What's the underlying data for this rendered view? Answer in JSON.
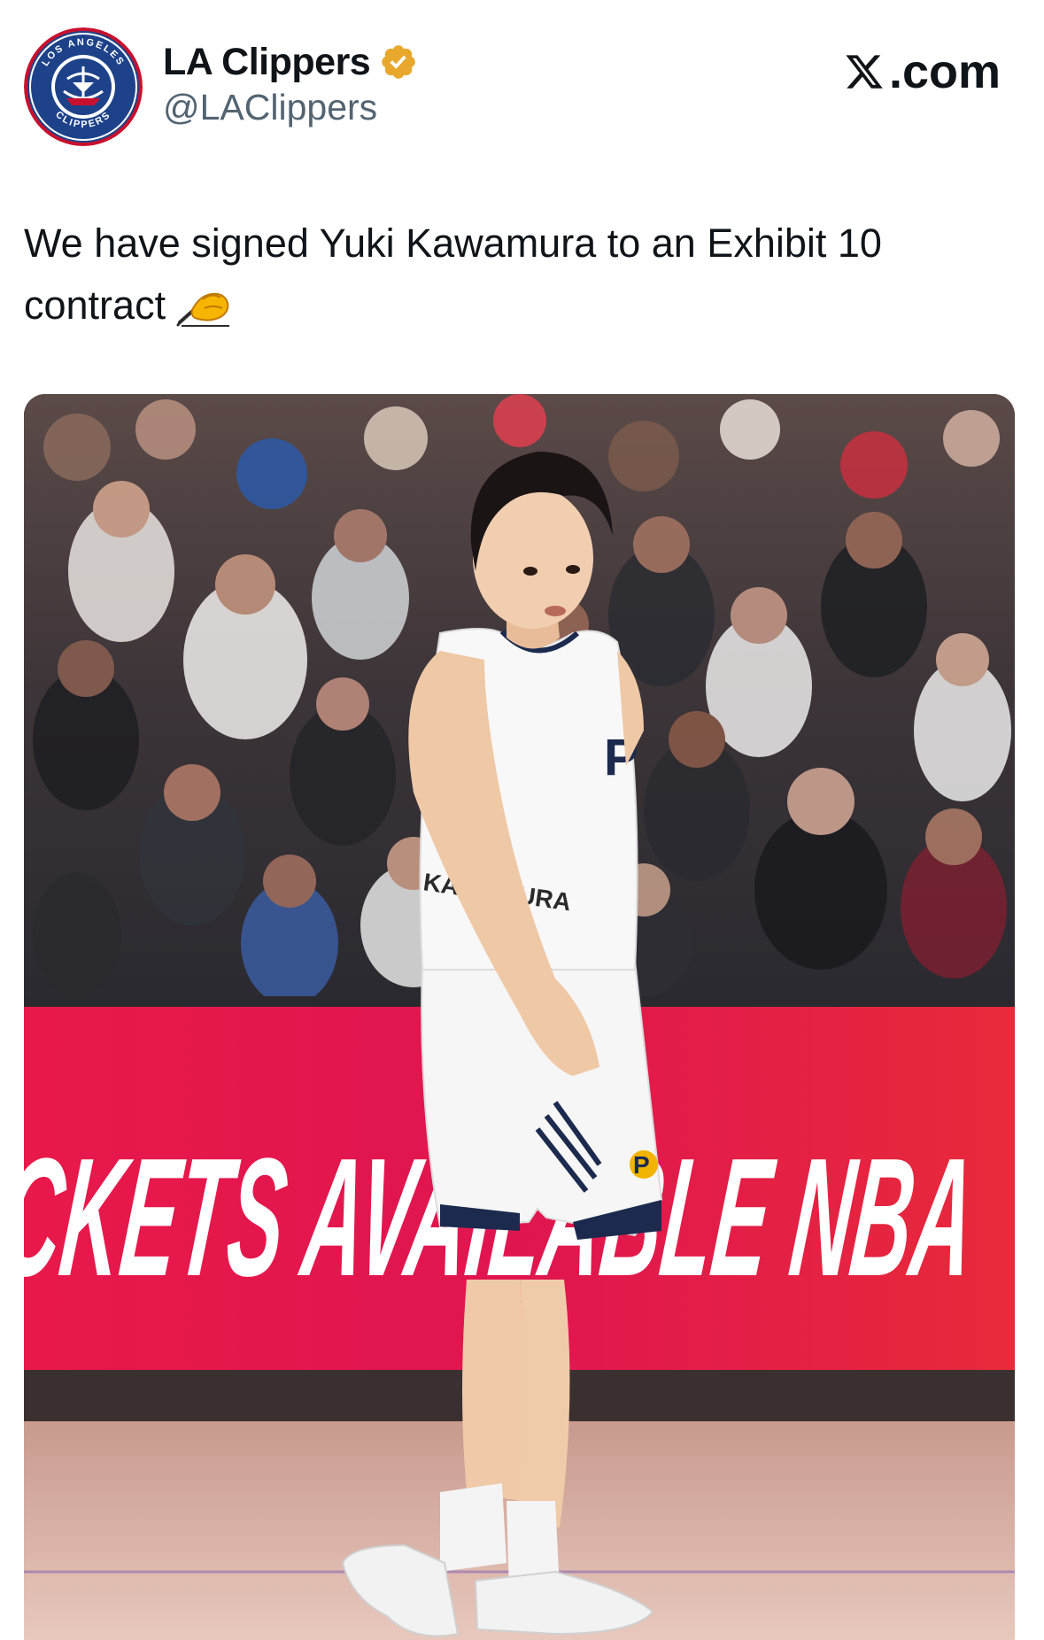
{
  "account": {
    "display_name": "LA Clippers",
    "handle": "@LAClippers",
    "verified": true,
    "verified_badge_color": "#e8a82c",
    "avatar": {
      "icon": "la-clippers-logo",
      "ring_top_text": "LOS ANGELES",
      "ring_bottom_text": "CLIPPERS",
      "colors": {
        "navy": "#1d428a",
        "red": "#c8102e",
        "white": "#ffffff"
      }
    }
  },
  "brand": {
    "icon": "x-logo-icon",
    "label": ".com"
  },
  "post": {
    "text": "We have signed Yuki Kawamura to an Exhibit 10 contract",
    "emoji": "writing-hand-emoji"
  },
  "photo": {
    "banner_text": "TICKETS AVAILABLE NBA",
    "banner_color": "#e1194a",
    "jersey_text": "KAWAMURA",
    "jersey_letter": "P",
    "team_logo": "pacers-logo",
    "subject": "basketball player in white jersey on court"
  }
}
